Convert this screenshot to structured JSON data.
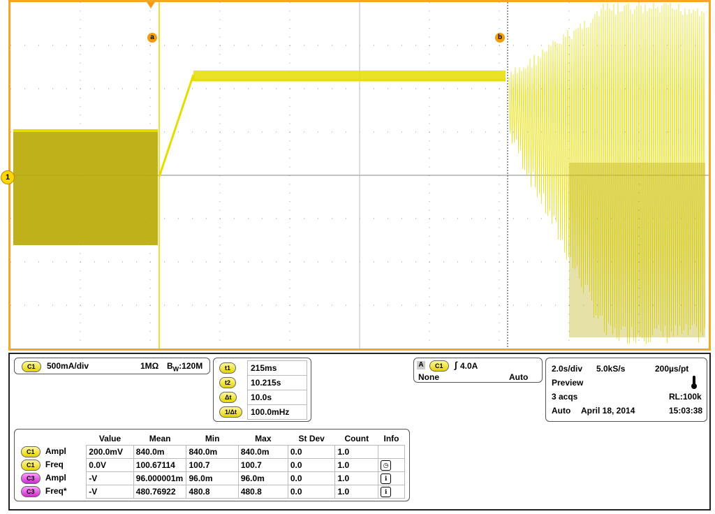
{
  "markers": {
    "a": "a",
    "b": "b",
    "channel": "1"
  },
  "channel": {
    "pill": "C1",
    "scale": "500mA/div",
    "impedance": "1MΩ",
    "bw_prefix": "B",
    "bw_sub": "W",
    "bw_value": ":120M"
  },
  "cursors": [
    {
      "label": "t1",
      "value": "215ms"
    },
    {
      "label": "t2",
      "value": "10.215s"
    },
    {
      "label": "Δt",
      "value": "10.0s"
    },
    {
      "label": "1/Δt",
      "value": "100.0mHz"
    }
  ],
  "trigger": {
    "mode_letter": "A",
    "pill": "C1",
    "level": "4.0A",
    "coupling": "None",
    "sweep": "Auto"
  },
  "timebase": {
    "div": "2.0s/div",
    "rate": "5.0kS/s",
    "pt": "200µs/pt",
    "state": "Preview",
    "acqs": "3 acqs",
    "rl": "RL:100k",
    "mode": "Auto",
    "date": "April 18, 2014",
    "time": "15:03:38"
  },
  "measurements": {
    "headers": [
      "Value",
      "Mean",
      "Min",
      "Max",
      "St Dev",
      "Count",
      "Info"
    ],
    "rows": [
      {
        "pill": "C1",
        "pill_color": "yellow",
        "name": "Ampl",
        "value": "200.0mV",
        "mean": "840.0m",
        "min": "840.0m",
        "max": "840.0m",
        "stdev": "0.0",
        "count": "1.0",
        "info": ""
      },
      {
        "pill": "C1",
        "pill_color": "yellow",
        "name": "Freq",
        "value": "0.0V",
        "mean": "100.67114",
        "min": "100.7",
        "max": "100.7",
        "stdev": "0.0",
        "count": "1.0",
        "info": "clock-icon"
      },
      {
        "pill": "C3",
        "pill_color": "magenta",
        "name": "Ampl",
        "value": "-V",
        "mean": "96.000001m",
        "min": "96.0m",
        "max": "96.0m",
        "stdev": "0.0",
        "count": "1.0",
        "info": "info-icon"
      },
      {
        "pill": "C3",
        "pill_color": "magenta",
        "name": "Freq*",
        "value": "-V",
        "mean": "480.76922",
        "min": "480.8",
        "max": "480.8",
        "stdev": "0.0",
        "count": "1.0",
        "info": "info-icon"
      }
    ]
  },
  "colors": {
    "trace": "#e6dd00",
    "trace_dark": "#b8a800",
    "frame": "#f5a623",
    "grid": "#999999"
  }
}
